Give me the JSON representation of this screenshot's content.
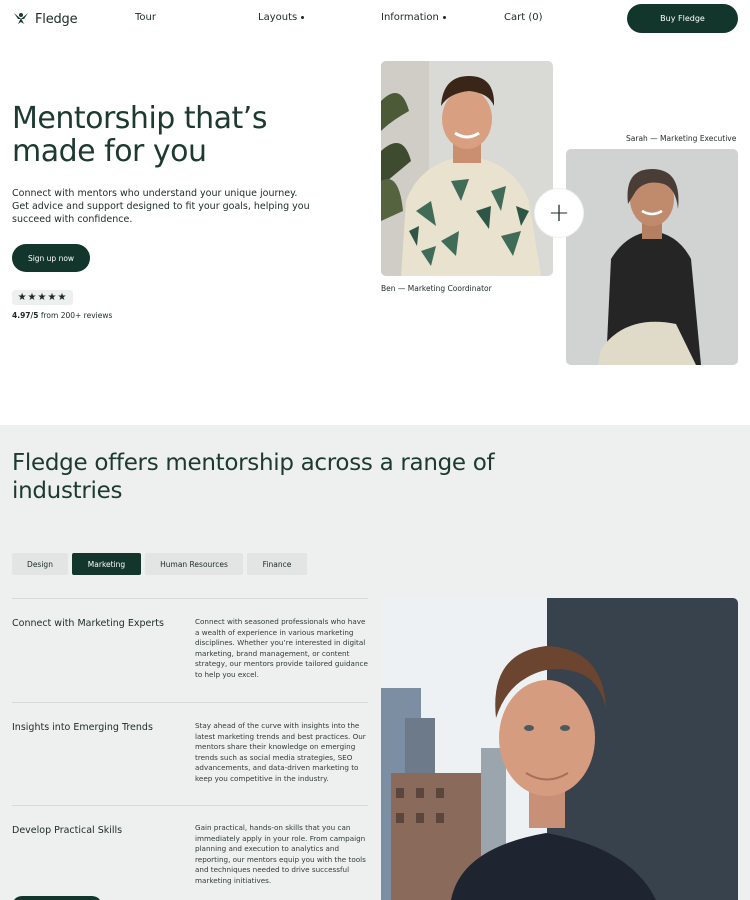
{
  "nav": {
    "brand": "Fledge",
    "links": [
      {
        "label": "Tour",
        "dot": false
      },
      {
        "label": "Layouts",
        "dot": true
      },
      {
        "label": "Information",
        "dot": true
      },
      {
        "label": "Cart (0)",
        "dot": false
      }
    ],
    "cta": "Buy Fledge"
  },
  "hero": {
    "title": "Mentorship that’s made for you",
    "description": "Connect with mentors who understand your unique journey. Get advice and support designed to fit your goals, helping you succeed with confidence.",
    "cta": "Sign up now",
    "stars": "★★★★★",
    "rating_value": "4.97/5",
    "rating_text": " from 200+ reviews",
    "mentors": [
      {
        "caption": "Ben — Marketing Coordinator"
      },
      {
        "caption": "Sarah — Marketing Executive"
      }
    ],
    "plus": "+"
  },
  "industries": {
    "title": "Fledge offers mentorship across a range of industries",
    "tabs": [
      {
        "label": "Design",
        "active": false
      },
      {
        "label": "Marketing",
        "active": true
      },
      {
        "label": "Human Resources",
        "active": false
      },
      {
        "label": "Finance",
        "active": false
      }
    ],
    "features": [
      {
        "title": "Connect with Marketing Experts",
        "text": "Connect with seasoned professionals who have a wealth of experience in various marketing disciplines. Whether you’re interested in digital marketing, brand management, or content strategy, our mentors provide tailored guidance to help you excel."
      },
      {
        "title": "Insights into Emerging Trends",
        "text": "Stay ahead of the curve with insights into the latest marketing trends and best practices. Our mentors share their knowledge on emerging trends such as social media strategies, SEO advancements, and data-driven marketing to keep you competitive in the industry."
      },
      {
        "title": "Develop Practical Skills",
        "text": "Gain practical, hands-on skills that you can immediately apply in your role. From campaign planning and execution to analytics and reporting, our mentors equip you with the tools and techniques needed to drive successful marketing initiatives."
      }
    ]
  },
  "colors": {
    "primary": "#12362b",
    "section_bg": "#eef0ef",
    "text": "#1c2b25"
  }
}
